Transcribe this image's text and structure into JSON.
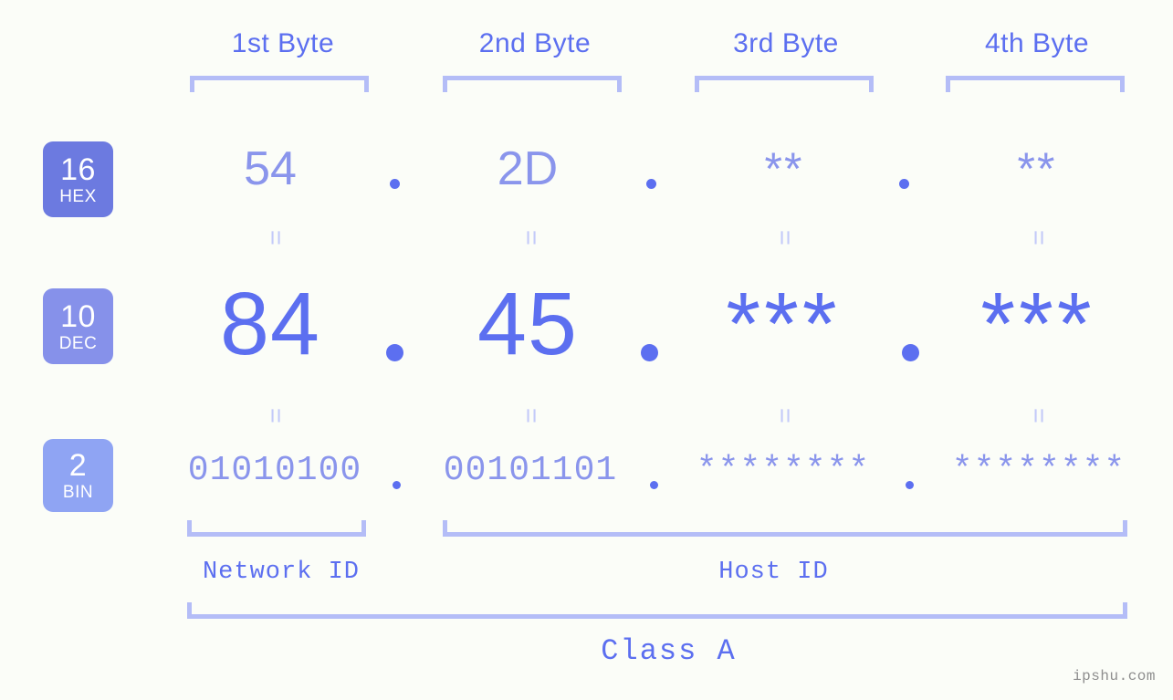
{
  "meta": {
    "background_color": "#fbfdf8",
    "accent_color": "#5c6ff0",
    "accent_light": "#8a95ec",
    "bracket_color": "#b4bdf7",
    "equals_color": "#c3caf9",
    "watermark_color": "#8e8e8e"
  },
  "columns": [
    {
      "header": "1st Byte"
    },
    {
      "header": "2nd Byte"
    },
    {
      "header": "3rd Byte"
    },
    {
      "header": "4th Byte"
    }
  ],
  "bases": [
    {
      "number": "16",
      "name": "HEX",
      "color": "#6c7ae0"
    },
    {
      "number": "10",
      "name": "DEC",
      "color": "#8691ea"
    },
    {
      "number": "2",
      "name": "BIN",
      "color": "#8fa4f3"
    }
  ],
  "rows": {
    "hex": {
      "base_number": "16",
      "base_name": "HEX",
      "values": [
        "54",
        "2D",
        "**",
        "**"
      ]
    },
    "dec": {
      "base_number": "10",
      "base_name": "DEC",
      "values": [
        "84",
        "45",
        "***",
        "***"
      ]
    },
    "bin": {
      "base_number": "2",
      "base_name": "BIN",
      "values": [
        "01010100",
        "00101101",
        "********",
        "********"
      ]
    }
  },
  "separators": {
    "hex": [
      ".",
      ".",
      "."
    ],
    "dec": [
      ".",
      ".",
      "."
    ],
    "bin": [
      ".",
      ".",
      "."
    ]
  },
  "equals": {
    "hex_to_dec": [
      "=",
      "=",
      "=",
      "="
    ],
    "dec_to_bin": [
      "=",
      "=",
      "=",
      "="
    ]
  },
  "sections": {
    "network_id": "Network ID",
    "host_id": "Host ID",
    "class": "Class A"
  },
  "watermark": "ipshu.com"
}
